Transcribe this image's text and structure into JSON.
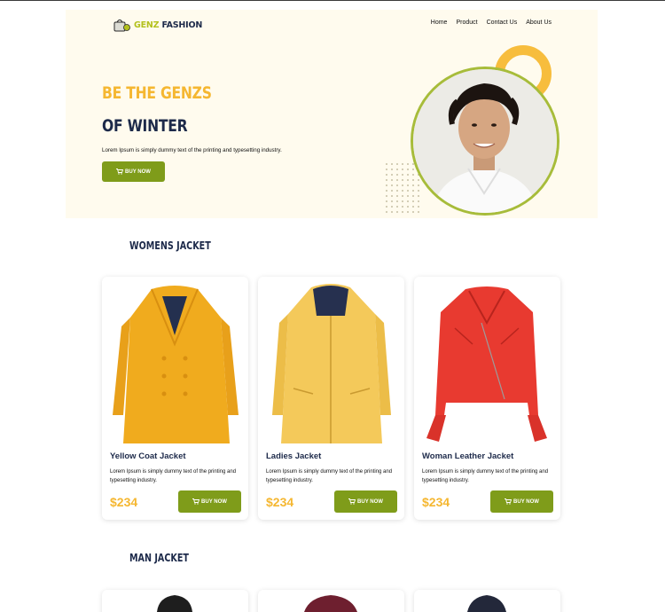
{
  "brand": {
    "part1": "GENZ",
    "part2": "FASHION"
  },
  "nav": [
    "Home",
    "Product",
    "Contact Us",
    "About Us"
  ],
  "hero": {
    "title_line1": "BE THE GENZS",
    "title_line2": "OF WINTER",
    "description": "Lorem Ipsum is simply dummy text of the printing and typesetting industry.",
    "button_label": "BUY NOW"
  },
  "womens": {
    "title": "WOMENS JACKET",
    "products": [
      {
        "name": "Yellow Coat Jacket",
        "description": "Lorem Ipsum is simply dummy text of the printing and typesetting industry.",
        "price": "$234",
        "button_label": "BUY NOW"
      },
      {
        "name": "Ladies Jacket",
        "description": "Lorem Ipsum is simply dummy text of the printing and typesetting industry.",
        "price": "$234",
        "button_label": "BUY NOW"
      },
      {
        "name": "Woman Leather Jacket",
        "description": "Lorem Ipsum is simply dummy text of the printing and typesetting industry.",
        "price": "$234",
        "button_label": "BUY NOW"
      }
    ]
  },
  "mens": {
    "title": "MAN JACKET"
  },
  "colors": {
    "accent_green": "#7f9c1a",
    "accent_yellow": "#f5b731",
    "navy": "#1d2a4a",
    "hero_bg": "#fffbee"
  }
}
